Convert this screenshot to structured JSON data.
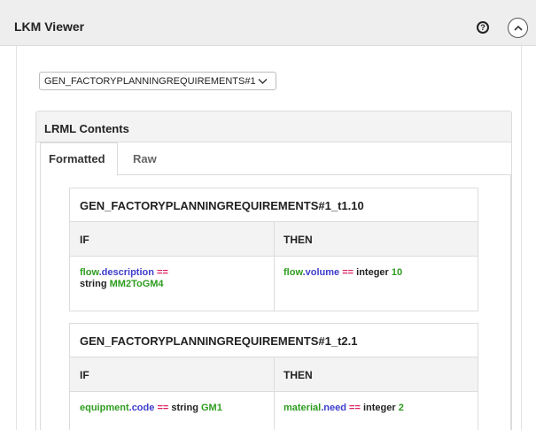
{
  "header": {
    "title": "LKM Viewer",
    "help_icon": "help-circle-icon",
    "collapse_icon": "chevron-up-icon"
  },
  "selector": {
    "value": "GEN_FACTORYPLANNINGREQUIREMENTS#1"
  },
  "lrml": {
    "title": "LRML Contents",
    "tabs": [
      {
        "label": "Formatted",
        "active": true
      },
      {
        "label": "Raw",
        "active": false
      }
    ],
    "rules": [
      {
        "name": "GEN_FACTORYPLANNINGREQUIREMENTS#1_t1.10",
        "if_label": "IF",
        "then_label": "THEN",
        "if": {
          "obj": "flow",
          "dot": ".",
          "prop": "description",
          "op": "==",
          "type": "string",
          "value": "MM2ToGM4"
        },
        "then": {
          "obj": "flow",
          "dot": ".",
          "prop": "volume",
          "op": "==",
          "type": "integer",
          "value": "10"
        }
      },
      {
        "name": "GEN_FACTORYPLANNINGREQUIREMENTS#1_t2.1",
        "if_label": "IF",
        "then_label": "THEN",
        "if": {
          "obj": "equipment",
          "dot": ".",
          "prop": "code",
          "op": "==",
          "type": "string",
          "value": "GM1"
        },
        "then": {
          "obj": "material",
          "dot": ".",
          "prop": "need",
          "op": "==",
          "type": "integer",
          "value": "2"
        }
      }
    ]
  },
  "colors": {
    "object": "#2e9c1f",
    "property": "#3d3dcc",
    "operator": "#e0245e",
    "header_bg": "#eeeeee"
  }
}
